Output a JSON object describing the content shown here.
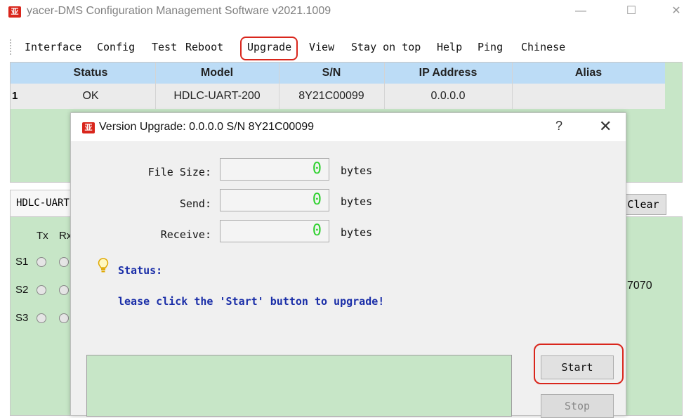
{
  "app": {
    "title": "yacer-DMS Configuration Management Software v2021.1009",
    "logo_glyph": "亚"
  },
  "window_controls": {
    "minimize": "—",
    "maximize": "☐",
    "close": "✕"
  },
  "menu": {
    "items": [
      "Interface",
      "Config",
      "Test",
      "Reboot",
      "Upgrade",
      "View",
      "Stay on top",
      "Help",
      "Ping",
      "Chinese"
    ],
    "highlighted": "Upgrade",
    "highlight_color": "#d9261c"
  },
  "device_table": {
    "columns": [
      "Status",
      "Model",
      "S/N",
      "IP Address",
      "Alias"
    ],
    "rows": [
      {
        "index": "1",
        "status": "OK",
        "model": "HDLC-UART-200",
        "sn": "8Y21C00099",
        "ip": "0.0.0.0",
        "alias": ""
      }
    ]
  },
  "lower_panel": {
    "tab_label": "HDLC-UART",
    "clear_label": "Clear",
    "led_headers": [
      "Tx",
      "Rx"
    ],
    "rows": [
      "S1",
      "S2",
      "S3"
    ],
    "partial_value": "7070"
  },
  "dialog": {
    "title": "Version Upgrade: 0.0.0.0  S/N 8Y21C00099",
    "help": "?",
    "close": "✕",
    "fields": [
      {
        "label": "File Size:",
        "value": "0",
        "unit": "bytes"
      },
      {
        "label": "Send:",
        "value": "0",
        "unit": "bytes"
      },
      {
        "label": "Receive:",
        "value": "0",
        "unit": "bytes"
      }
    ],
    "status_title": "Status:",
    "status_message": "lease click the 'Start' button to upgrade!",
    "start_label": "Start",
    "stop_label": "Stop"
  },
  "colors": {
    "table_header": "#bcdcf6",
    "panel_green": "#c7e6c7",
    "status_text": "#1a2ea8",
    "lcd_digit": "#2fd12f"
  }
}
